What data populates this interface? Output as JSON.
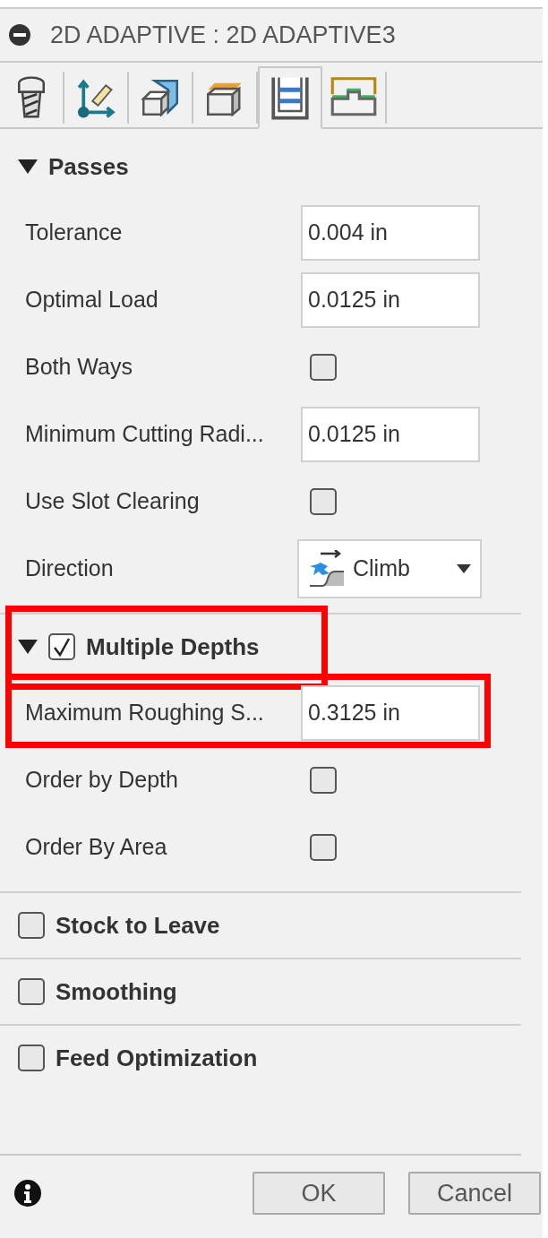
{
  "window": {
    "title": "2D ADAPTIVE : 2D ADAPTIVE3"
  },
  "tabs": [
    {
      "selected": false
    },
    {
      "selected": false
    },
    {
      "selected": false
    },
    {
      "selected": false
    },
    {
      "selected": true
    },
    {
      "selected": false
    }
  ],
  "sections": [
    {
      "kind": "group",
      "title": "Passes",
      "expanded": true,
      "highlighted": false,
      "rows": [
        {
          "kind": "text",
          "label": "Tolerance",
          "value": "0.004 in",
          "highlighted": false
        },
        {
          "kind": "text",
          "label": "Optimal Load",
          "value": "0.0125 in",
          "highlighted": false
        },
        {
          "kind": "checkbox",
          "label": "Both Ways",
          "checked": false,
          "highlighted": false
        },
        {
          "kind": "text",
          "label": "Minimum Cutting Radi...",
          "value": "0.0125 in",
          "highlighted": false
        },
        {
          "kind": "checkbox",
          "label": "Use Slot Clearing",
          "checked": false,
          "highlighted": false
        },
        {
          "kind": "dropdown",
          "label": "Direction",
          "value": "Climb",
          "highlighted": false
        }
      ]
    },
    {
      "kind": "option",
      "title": "Multiple Depths",
      "expanded": true,
      "checked": true,
      "highlighted": true,
      "rows": [
        {
          "kind": "text",
          "label": "Maximum Roughing S...",
          "value": "0.3125 in",
          "highlighted": true
        },
        {
          "kind": "checkbox",
          "label": "Order by Depth",
          "checked": false,
          "highlighted": false
        },
        {
          "kind": "checkbox",
          "label": "Order By Area",
          "checked": false,
          "highlighted": false
        }
      ]
    },
    {
      "kind": "option",
      "title": "Stock to Leave",
      "expanded": false,
      "checked": false,
      "highlighted": false
    },
    {
      "kind": "option",
      "title": "Smoothing",
      "expanded": false,
      "checked": false,
      "highlighted": false
    },
    {
      "kind": "option",
      "title": "Feed Optimization",
      "expanded": false,
      "checked": false,
      "highlighted": false
    }
  ],
  "buttons": [
    {
      "label": "OK"
    },
    {
      "label": "Cancel"
    }
  ]
}
